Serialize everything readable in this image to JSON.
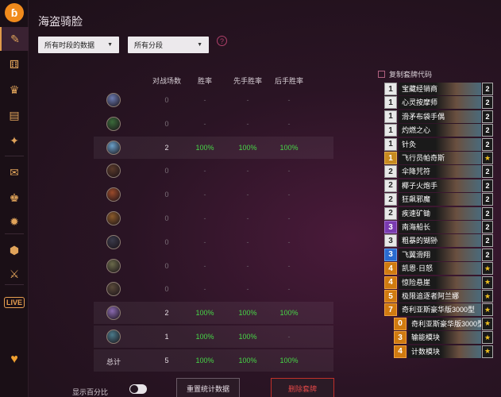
{
  "sidebar": {
    "logo": "ɓ",
    "items": [
      {
        "icon": "hearthstone-deck-icon",
        "glyph": "✎",
        "active": true
      },
      {
        "icon": "dice-icon",
        "glyph": "⚅"
      },
      {
        "icon": "trophy-icon",
        "glyph": "♛"
      },
      {
        "icon": "cards-icon",
        "glyph": "▤"
      },
      {
        "icon": "battlegrounds-icon",
        "glyph": "✦"
      },
      {
        "icon": "card-collection-icon",
        "glyph": "✉"
      },
      {
        "icon": "crown-icon",
        "glyph": "♚"
      },
      {
        "icon": "arena-icon",
        "glyph": "✹"
      },
      {
        "icon": "shield-icon",
        "glyph": "⬢"
      },
      {
        "icon": "crossed-swords-icon",
        "glyph": "⚔"
      },
      {
        "icon": "live-icon",
        "glyph": "LIVE"
      },
      {
        "icon": "heart-icon",
        "glyph": "♥"
      }
    ]
  },
  "page": {
    "title": "海盗骑脸",
    "filter_time": "所有时段的数据",
    "filter_rank": "所有分段",
    "help": "?"
  },
  "table": {
    "headers": [
      "对战场数",
      "胜率",
      "先手胜率",
      "后手胜率"
    ],
    "rows": [
      {
        "hero": "mage",
        "color": "#6a7ab0",
        "games": "0",
        "wr": "-",
        "first": "-",
        "second": "-"
      },
      {
        "hero": "druid",
        "color": "#3a6a3a",
        "games": "0",
        "wr": "-",
        "first": "-",
        "second": "-"
      },
      {
        "hero": "shaman",
        "color": "#6aa0c8",
        "games": "2",
        "wr": "100%",
        "first": "100%",
        "second": "100%"
      },
      {
        "hero": "rogue",
        "color": "#5a3a2a",
        "games": "0",
        "wr": "-",
        "first": "-",
        "second": "-"
      },
      {
        "hero": "warrior",
        "color": "#9a4a2a",
        "games": "0",
        "wr": "-",
        "first": "-",
        "second": "-"
      },
      {
        "hero": "hunter",
        "color": "#8a5a2a",
        "games": "0",
        "wr": "-",
        "first": "-",
        "second": "-"
      },
      {
        "hero": "warlock",
        "color": "#3a3a4a",
        "games": "0",
        "wr": "-",
        "first": "-",
        "second": "-"
      },
      {
        "hero": "paladin",
        "color": "#6a6a4a",
        "games": "0",
        "wr": "-",
        "first": "-",
        "second": "-"
      },
      {
        "hero": "priest",
        "color": "#5a4a3a",
        "games": "0",
        "wr": "-",
        "first": "-",
        "second": "-"
      },
      {
        "hero": "demon-hunter",
        "color": "#8a6ab0",
        "games": "2",
        "wr": "100%",
        "first": "100%",
        "second": "100%"
      },
      {
        "hero": "death-knight",
        "color": "#4a7a8a",
        "games": "1",
        "wr": "100%",
        "first": "100%",
        "second": "-"
      }
    ],
    "total": {
      "label": "总计",
      "games": "5",
      "wr": "100%",
      "first": "100%",
      "second": "100%"
    }
  },
  "bottom": {
    "show_percent": "显示百分比",
    "reset_button": "重置统计数据",
    "delete_button": "删除套牌"
  },
  "deck": {
    "copy_label": "复制套牌代码",
    "cards": [
      {
        "cost": "1",
        "name": "宝藏经销商",
        "count": "2",
        "costClass": "c1"
      },
      {
        "cost": "1",
        "name": "心灵按摩师",
        "count": "2",
        "costClass": "c1"
      },
      {
        "cost": "1",
        "name": "滑矛布袋手偶",
        "count": "2",
        "costClass": "c1"
      },
      {
        "cost": "1",
        "name": "灼燃之心",
        "count": "2",
        "costClass": "c1"
      },
      {
        "cost": "1",
        "name": "针灸",
        "count": "2",
        "costClass": "c1"
      },
      {
        "cost": "1",
        "name": "飞行员帕奇斯",
        "count": "★",
        "costClass": "gold"
      },
      {
        "cost": "2",
        "name": "伞降咒符",
        "count": "2",
        "costClass": "c2"
      },
      {
        "cost": "2",
        "name": "椰子火炮手",
        "count": "2",
        "costClass": "c2"
      },
      {
        "cost": "2",
        "name": "狂飙邪魔",
        "count": "2",
        "costClass": "c2"
      },
      {
        "cost": "2",
        "name": "疾速矿锄",
        "count": "2",
        "costClass": "c2"
      },
      {
        "cost": "3",
        "name": "南海船长",
        "count": "2",
        "costClass": "purple"
      },
      {
        "cost": "3",
        "name": "粗暴的猢狲",
        "count": "2",
        "costClass": "c2"
      },
      {
        "cost": "3",
        "name": "飞翼滑翔",
        "count": "2",
        "costClass": "blue"
      },
      {
        "cost": "4",
        "name": "凯恩·日怒",
        "count": "★",
        "costClass": "orange"
      },
      {
        "cost": "4",
        "name": "惊险悬崖",
        "count": "★",
        "costClass": "orange"
      },
      {
        "cost": "5",
        "name": "极限追逐者阿兰娜",
        "count": "★",
        "costClass": "orange"
      },
      {
        "cost": "7",
        "name": "奇利亚斯豪华版3000型",
        "count": "★",
        "costClass": "orange"
      },
      {
        "cost": "0",
        "name": "奇利亚斯豪华版3000型",
        "count": "★",
        "costClass": "orange",
        "indent": true
      },
      {
        "cost": "3",
        "name": "输能模块",
        "count": "★",
        "costClass": "orange",
        "indent": true
      },
      {
        "cost": "4",
        "name": "计数模块",
        "count": "★",
        "costClass": "orange",
        "indent": true
      }
    ]
  }
}
